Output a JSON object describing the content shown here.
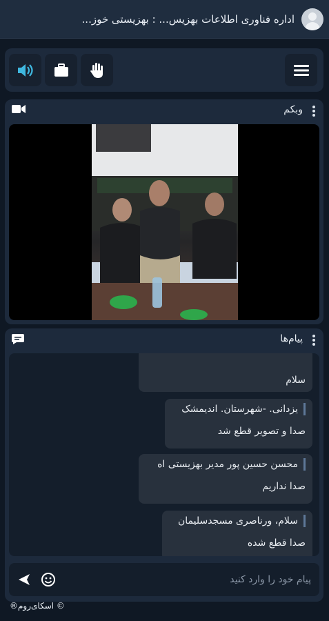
{
  "header": {
    "title": "اداره فناوری اطلاعات بهزیس... : بهزیستی خوز..."
  },
  "toolbar": {
    "buttons": [
      {
        "icon": "speaker-icon",
        "active": true
      },
      {
        "icon": "briefcase-icon"
      },
      {
        "icon": "raise-hand-icon"
      }
    ],
    "menu_icon": "hamburger-menu-icon"
  },
  "webcam": {
    "title": "وبکم",
    "icon": "video-camera-icon"
  },
  "chat": {
    "title": "پیام‌ها",
    "icon": "chat-bubble-icon",
    "messages": [
      {
        "text": "سلام"
      },
      {
        "sender": "یزدانی. -شهرستان. اندیمشک",
        "text": "صدا و تصویر قطع شد"
      },
      {
        "sender": "محسن حسین پور مدیر بهزیستی اه",
        "text": "صدا نداریم"
      },
      {
        "sender": "سلام، ورناصری مسجدسلیمان",
        "text": "صدا قطع شده"
      }
    ],
    "input_placeholder": "پیام خود را وارد کنید"
  },
  "footer": {
    "text": "®اسکای‌روم ©"
  },
  "colors": {
    "accent": "#3fb8e0",
    "background": "#0f1824",
    "panel": "#1d2a3c"
  }
}
